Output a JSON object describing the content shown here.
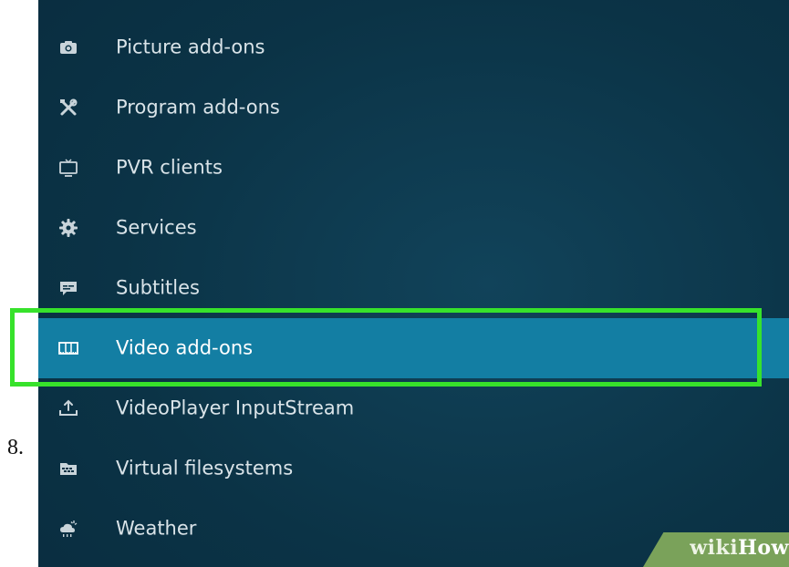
{
  "step_number": "8.",
  "menu": {
    "items": [
      {
        "label": "Picture add-ons",
        "icon": "camera-icon"
      },
      {
        "label": "Program add-ons",
        "icon": "tools-icon"
      },
      {
        "label": "PVR clients",
        "icon": "tv-icon"
      },
      {
        "label": "Services",
        "icon": "gear-icon"
      },
      {
        "label": "Subtitles",
        "icon": "subtitles-icon"
      },
      {
        "label": "Video add-ons",
        "icon": "film-icon",
        "selected": true
      },
      {
        "label": "VideoPlayer InputStream",
        "icon": "upload-icon"
      },
      {
        "label": "Virtual filesystems",
        "icon": "folder-icon"
      },
      {
        "label": "Weather",
        "icon": "weather-icon"
      }
    ]
  },
  "watermark": {
    "wiki": "wiki",
    "how": "How"
  },
  "colors": {
    "background": "#0b3346",
    "selected_row": "#137ea3",
    "highlight_border": "#37e22b",
    "text": "#d9e3e8"
  }
}
